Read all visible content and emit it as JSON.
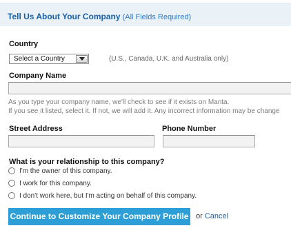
{
  "header": {
    "title": "Tell Us About Your Company",
    "subtitle": "(All Fields Required)"
  },
  "country": {
    "label": "Country",
    "select_value": "Select a Country",
    "note": "(U.S., Canada, U.K. and Australia only)"
  },
  "company_name": {
    "label": "Company Name",
    "value": "",
    "help_line1": "As you type your company name, we'll check to see if it exists on Manta.",
    "help_line2": "If you see it listed, select it. If not, we will add it. Any incorrect information may be change"
  },
  "street_address": {
    "label": "Street Address",
    "value": ""
  },
  "phone_number": {
    "label": "Phone Number",
    "value": ""
  },
  "relationship": {
    "question": "What is your relationship to this company?",
    "options": [
      "I'm the owner of this company.",
      "I work for this company.",
      "I don't work here, but I'm acting on behalf of this company."
    ]
  },
  "actions": {
    "continue_label": "Continue to Customize Your Company Profile",
    "or_text": "or",
    "cancel_label": "Cancel"
  },
  "colors": {
    "header_bg": "#eaf2f8",
    "title_blue": "#1a60a8",
    "button_blue": "#2d9fd6"
  },
  "icons": {
    "select_arrow": "chevron-down-icon",
    "radio": "radio-button-icon"
  }
}
